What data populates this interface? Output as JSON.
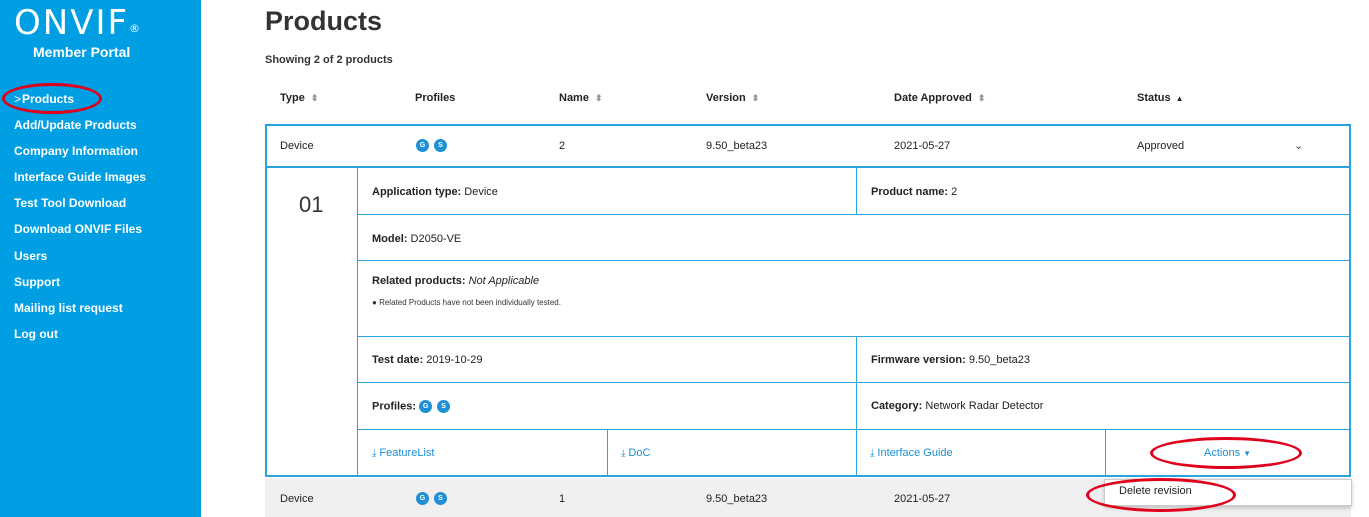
{
  "sidebar": {
    "logo": "ONVIF",
    "logo_mark": "®",
    "subtitle": "Member Portal",
    "active_indicator": ">",
    "items": [
      {
        "label": "Products"
      },
      {
        "label": "Add/Update Products"
      },
      {
        "label": "Company Information"
      },
      {
        "label": "Interface Guide Images"
      },
      {
        "label": "Test Tool Download"
      },
      {
        "label": "Download ONVIF Files"
      },
      {
        "label": "Users"
      },
      {
        "label": "Support"
      },
      {
        "label": "Mailing list request"
      },
      {
        "label": "Log out"
      }
    ]
  },
  "main": {
    "title": "Products",
    "showing": "Showing 2 of 2 products",
    "columns": [
      "Type",
      "Profiles",
      "Name",
      "Version",
      "Date Approved",
      "Status"
    ],
    "rows": [
      {
        "type": "Device",
        "profiles": [
          "G",
          "S"
        ],
        "name": "2",
        "version": "9.50_beta23",
        "date": "2021-05-27",
        "status": "Approved"
      },
      {
        "type": "Device",
        "profiles": [
          "G",
          "S"
        ],
        "name": "1",
        "version": "9.50_beta23",
        "date": "2021-05-27"
      }
    ],
    "details": {
      "revision": "01",
      "app_type_label": "Application type:",
      "app_type": "Device",
      "product_name_label": "Product name:",
      "product_name": "2",
      "model_label": "Model:",
      "model": "D2050-VE",
      "related_label": "Related products:",
      "related": "Not Applicable",
      "related_note": "Related Products have not been individually tested.",
      "test_date_label": "Test date:",
      "test_date": "2019-10-29",
      "firmware_label": "Firmware version:",
      "firmware": "9.50_beta23",
      "profiles_label": "Profiles:",
      "profiles": [
        "G",
        "S"
      ],
      "category_label": "Category:",
      "category": "Network Radar Detector",
      "links": {
        "featurelist": "FeatureList",
        "doc": "DoC",
        "interface_guide": "Interface Guide",
        "actions": "Actions"
      }
    },
    "actions_menu": {
      "items": [
        {
          "label": "Delete revision"
        }
      ]
    }
  },
  "icons": {
    "sort": "sort-icon",
    "sort_asc": "sort-asc-icon",
    "expand": "chevron-down-icon",
    "download": "download-icon",
    "info": "info-icon"
  },
  "colors": {
    "sidebar": "#009fe3",
    "border": "#2aa4dc",
    "link": "#1a8fd3",
    "badge": "#1f8fd6",
    "annotation": "#e0001b"
  }
}
